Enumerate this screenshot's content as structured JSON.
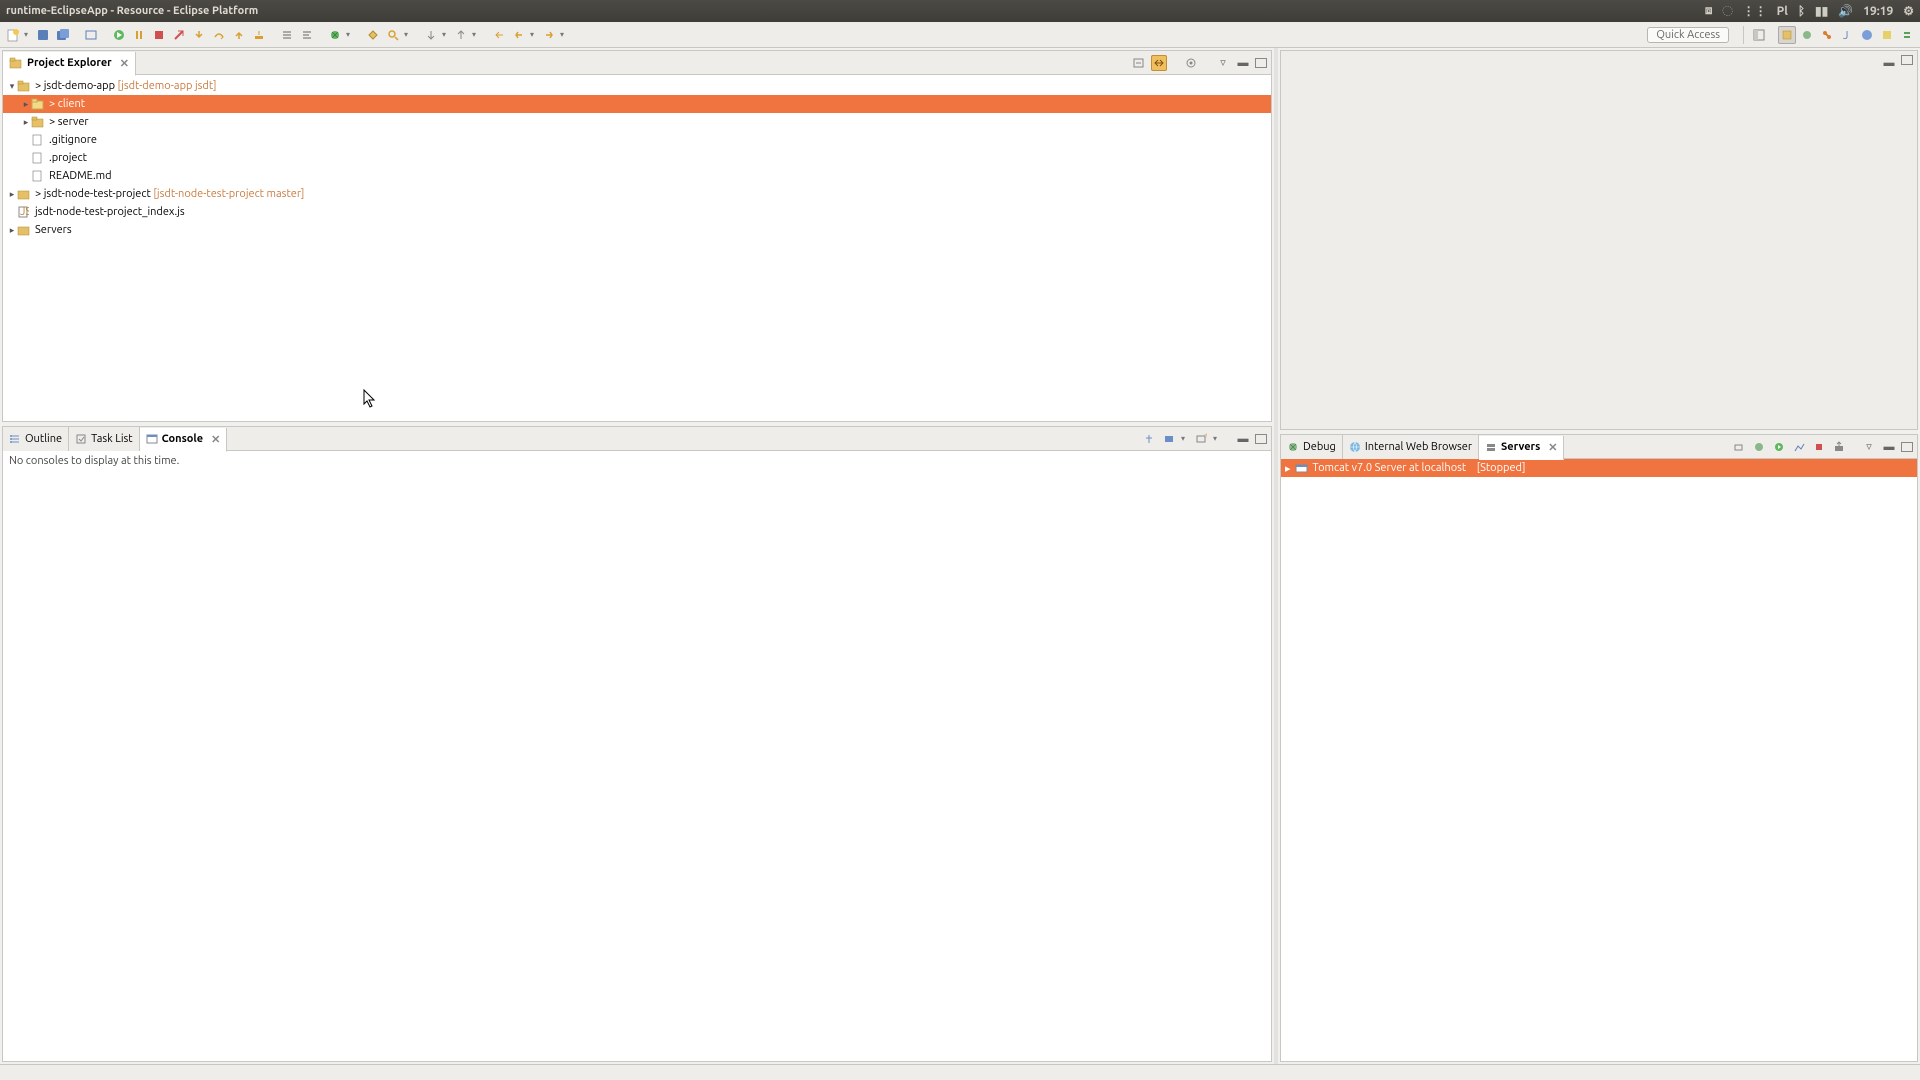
{
  "window": {
    "title": "runtime-EclipseApp - Resource - Eclipse Platform"
  },
  "systray": {
    "time": "19:19",
    "kb": "Pl"
  },
  "toolbar": {
    "quick_access": "Quick Access"
  },
  "project_explorer": {
    "title": "Project Explorer",
    "tree": {
      "p1": {
        "name": "> jsdt-demo-app",
        "decor": "[jsdt-demo-app jsdt]"
      },
      "p1_client": "> client",
      "p1_server": "> server",
      "p1_gitignore": ".gitignore",
      "p1_project": ".project",
      "p1_readme": "README.md",
      "p2": {
        "name": "> jsdt-node-test-project",
        "decor": "[jsdt-node-test-project master]"
      },
      "p3": "jsdt-node-test-project_index.js",
      "p4": "Servers"
    }
  },
  "outline": {
    "title": "Outline"
  },
  "tasklist": {
    "title": "Task List"
  },
  "console": {
    "title": "Console",
    "empty_msg": "No consoles to display at this time."
  },
  "debug": {
    "title": "Debug"
  },
  "browser": {
    "title": "Internal Web Browser"
  },
  "servers": {
    "title": "Servers",
    "item": {
      "name": "Tomcat v7.0 Server at localhost",
      "status": "[Stopped]"
    }
  }
}
